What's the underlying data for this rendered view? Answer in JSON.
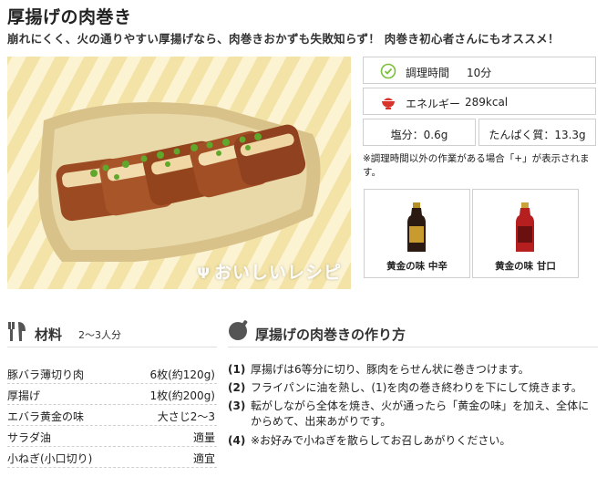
{
  "recipe": {
    "title": "厚揚げの肉巻き",
    "lead": "崩れにくく、火の通りやすい厚揚げなら、肉巻きおかずも失敗知らず！ 肉巻き初心者さんにもオススメ！"
  },
  "photo": {
    "watermark": "おいしいレシピ"
  },
  "info": {
    "time_label": "調理時間",
    "time_value": "10分",
    "energy_label": "エネルギー",
    "energy_value": "289kcal",
    "salt": "塩分：0.6g",
    "protein": "たんぱく質：13.3g",
    "note": "※調理時間以外の作業がある場合「+」が表示されます。"
  },
  "products": [
    {
      "label": "黄金の味 中辛",
      "color": "#2b1a12",
      "cap": "#b88f26"
    },
    {
      "label": "黄金の味 甘口",
      "color": "#b51f1f",
      "cap": "#c9a23a"
    }
  ],
  "ingredients": {
    "title": "材料",
    "servings": "2〜3人分",
    "items": [
      {
        "name": "豚バラ薄切り肉",
        "amount": "6枚(約120g)"
      },
      {
        "name": "厚揚げ",
        "amount": "1枚(約200g)"
      },
      {
        "name": "エバラ黄金の味",
        "amount": "大さじ2〜3"
      },
      {
        "name": "サラダ油",
        "amount": "適量"
      },
      {
        "name": "小ねぎ(小口切り)",
        "amount": "適宜"
      }
    ]
  },
  "steps": {
    "title": "厚揚げの肉巻きの作り方",
    "items": [
      {
        "no": "(1)",
        "text": "厚揚げは6等分に切り、豚肉をらせん状に巻きつけます。"
      },
      {
        "no": "(2)",
        "text": "フライパンに油を熱し、(1)を肉の巻き終わりを下にして焼きます。"
      },
      {
        "no": "(3)",
        "text": "転がしながら全体を焼き、火が通ったら「黄金の味」を加え、全体にからめて、出来あがりです。"
      },
      {
        "no": "(4)",
        "text": "※お好みで小ねぎを散らしてお召しあがりください。"
      }
    ]
  },
  "colors": {
    "accent_green": "#7cbf3a",
    "accent_red": "#d9342b",
    "icon_dark": "#555555"
  }
}
